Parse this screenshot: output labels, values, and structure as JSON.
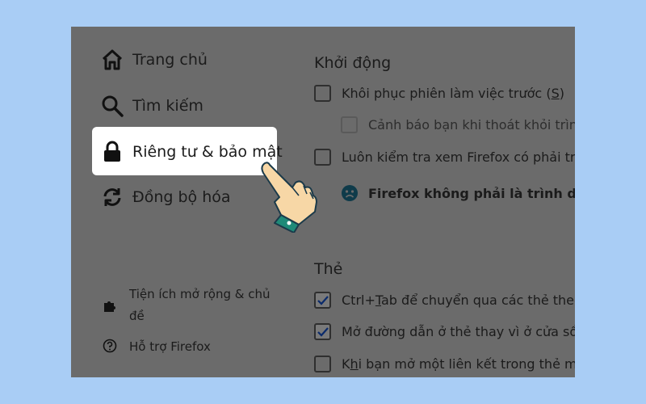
{
  "sidebar": {
    "items": [
      {
        "label": "Trang chủ",
        "icon": "home-icon"
      },
      {
        "label": "Tìm kiếm",
        "icon": "search-icon"
      },
      {
        "label": "Riêng tư & bảo mật",
        "icon": "lock-icon",
        "selected": true
      },
      {
        "label": "Đồng bộ hóa",
        "icon": "sync-icon"
      }
    ],
    "footer": [
      {
        "label_line1": "Tiện ích mở rộng & chủ",
        "label_line2": "đề",
        "icon": "puzzle-icon"
      },
      {
        "label": "Hỗ trợ Firefox",
        "icon": "help-icon"
      }
    ]
  },
  "startup": {
    "heading": "Khởi động",
    "restore_label_pre": "Khôi phục phiên làm việc trước (",
    "restore_label_key": "S",
    "restore_label_post": ")",
    "warn_quit": "Cảnh báo bạn khi thoát khỏi trình",
    "check_default": "Luôn kiểm tra xem Firefox có phải trìn",
    "not_default_notice": "Firefox không phải là trình duyệ"
  },
  "tabs": {
    "heading": "Thẻ",
    "ctrl_tab_pre": "Ctrl+",
    "ctrl_tab_key": "T",
    "ctrl_tab_post": "ab để chuyển qua các thẻ theo",
    "open_links": "Mở đường dẫn ở thẻ thay vì ở cửa sổ",
    "switch_pre": "K",
    "switch_key": "h",
    "switch_post": "i bạn mở một liên kết trong thẻ mớ"
  },
  "colors": {
    "background": "#a9cdf5",
    "panel": "#6b6b6b",
    "selected_item": "#ffffff",
    "hand_cuff": "#1f8a78",
    "hand_skin": "#f7d7a6"
  }
}
